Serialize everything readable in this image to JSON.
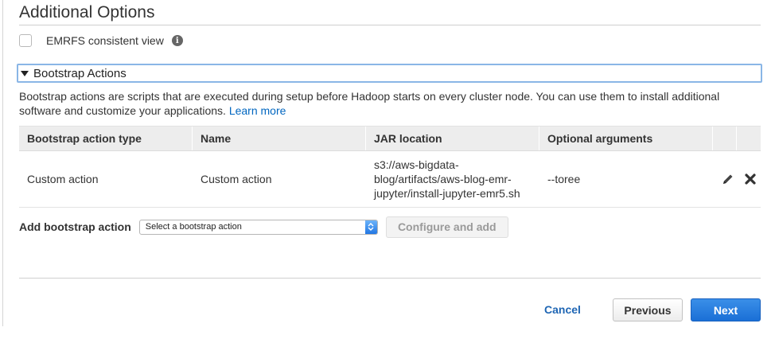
{
  "section": {
    "title": "Additional Options"
  },
  "emrfs": {
    "label": "EMRFS consistent view",
    "checked": false,
    "info_icon": "info-icon"
  },
  "bootstrap": {
    "header": "Bootstrap Actions",
    "description": "Bootstrap actions are scripts that are executed during setup before Hadoop starts on every cluster node. You can use them to install additional software and customize your applications.",
    "learn_more": "Learn more",
    "table": {
      "headers": [
        "Bootstrap action type",
        "Name",
        "JAR location",
        "Optional arguments"
      ],
      "rows": [
        {
          "type": "Custom action",
          "name": "Custom action",
          "jar": "s3://aws-bigdata-blog/artifacts/aws-blog-emr-jupyter/install-jupyter-emr5.sh",
          "jar_lines": [
            "s3://aws-bigdata-",
            "blog/artifacts/aws-blog-emr-",
            "jupyter/install-jupyter-emr5.sh"
          ],
          "args": "--toree",
          "edit_icon": "pencil-icon",
          "delete_icon": "close-icon"
        }
      ]
    },
    "add": {
      "label": "Add bootstrap action",
      "select_value": "Select a bootstrap action",
      "configure_button": "Configure and add"
    }
  },
  "footer": {
    "cancel": "Cancel",
    "previous": "Previous",
    "next": "Next"
  },
  "colors": {
    "link": "#0066c0",
    "primary": "#1a6fd6",
    "header_border": "#8ab6e6"
  }
}
